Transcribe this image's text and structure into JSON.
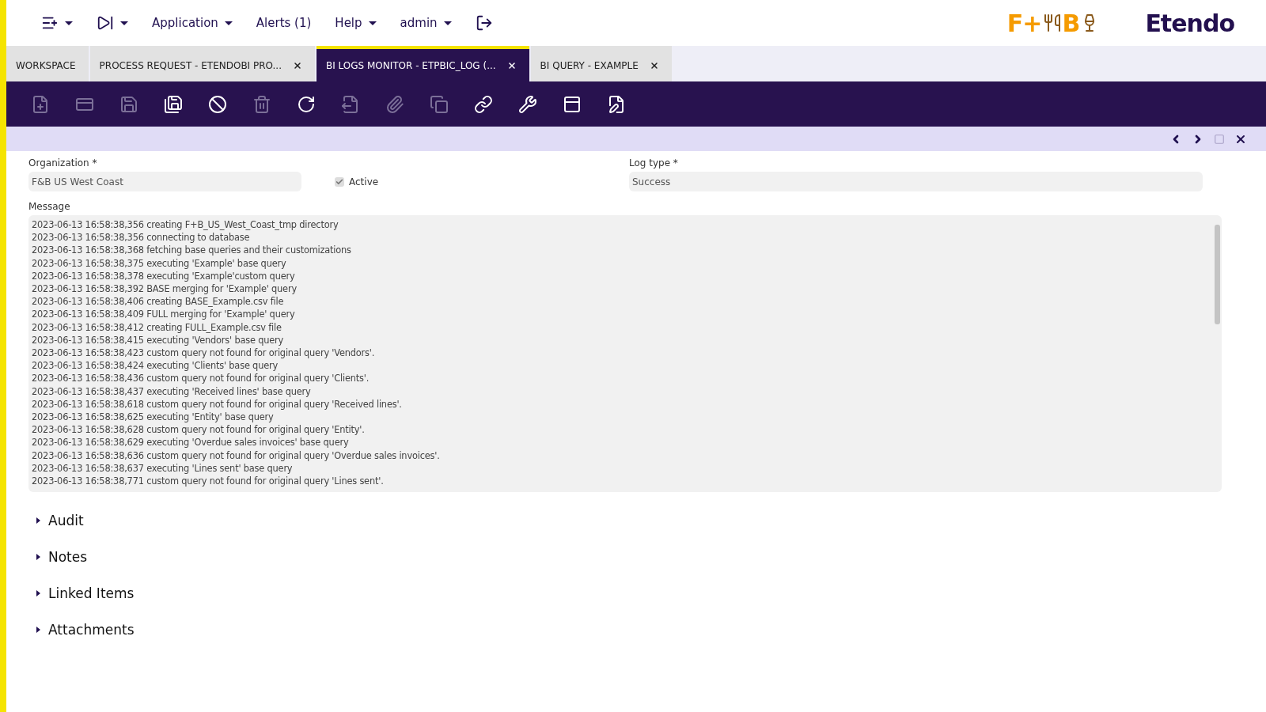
{
  "menu_bar": {
    "items": [
      {
        "kind": "icon"
      },
      {
        "kind": "icon"
      },
      {
        "kind": "dropdown",
        "label": "Application"
      },
      {
        "kind": "plain",
        "label": "Alerts (1)"
      },
      {
        "kind": "dropdown",
        "label": "Help"
      },
      {
        "kind": "dropdown",
        "label": "admin"
      },
      {
        "kind": "logout"
      }
    ]
  },
  "brand": {
    "client_logo": [
      "F+",
      "B"
    ],
    "product_logo": "Etendo"
  },
  "tabs": [
    {
      "label": "WORKSPACE",
      "selected": false,
      "closable": false
    },
    {
      "label": "PROCESS REQUEST - ETENDOBI PRO...",
      "selected": false,
      "closable": true
    },
    {
      "label": "BI LOGS MONITOR - ETPBIC_LOG (...",
      "selected": true,
      "closable": true
    },
    {
      "label": "BI QUERY - EXAMPLE",
      "selected": false,
      "closable": true
    }
  ],
  "toolbar": [
    {
      "kind": "new",
      "disabled": true
    },
    {
      "kind": "newrow",
      "disabled": true
    },
    {
      "kind": "save",
      "disabled": true
    },
    {
      "kind": "saveclose",
      "disabled": false
    },
    {
      "kind": "undo",
      "disabled": false
    },
    {
      "kind": "delete",
      "disabled": true
    },
    {
      "kind": "refresh",
      "disabled": false
    },
    {
      "kind": "export",
      "disabled": true
    },
    {
      "kind": "attach",
      "disabled": true
    },
    {
      "kind": "copy",
      "disabled": true
    },
    {
      "kind": "link",
      "disabled": false
    },
    {
      "kind": "tools",
      "disabled": false
    },
    {
      "kind": "view",
      "disabled": false
    },
    {
      "kind": "edit",
      "disabled": false
    }
  ],
  "form": {
    "organization": {
      "label": "Organization *",
      "value": "F&B US West Coast"
    },
    "active": {
      "label": "Active",
      "checked": true
    },
    "log_type": {
      "label": "Log type *",
      "value": "Success"
    },
    "message": {
      "label": "Message",
      "lines": [
        "2023-06-13 16:58:38,356 creating F+B_US_West_Coast_tmp directory",
        "2023-06-13 16:58:38,356 connecting to database",
        "2023-06-13 16:58:38,368 fetching base queries and their customizations",
        "2023-06-13 16:58:38,375 executing 'Example' base query",
        "2023-06-13 16:58:38,378 executing 'Example'custom query",
        "2023-06-13 16:58:38,392 BASE merging for 'Example' query",
        "2023-06-13 16:58:38,406 creating BASE_Example.csv file",
        "2023-06-13 16:58:38,409 FULL merging for 'Example' query",
        "2023-06-13 16:58:38,412 creating FULL_Example.csv file",
        "2023-06-13 16:58:38,415 executing 'Vendors' base query",
        "2023-06-13 16:58:38,423 custom query not found for original query 'Vendors'.",
        "2023-06-13 16:58:38,424 executing 'Clients' base query",
        "2023-06-13 16:58:38,436 custom query not found for original query 'Clients'.",
        "2023-06-13 16:58:38,437 executing 'Received lines' base query",
        "2023-06-13 16:58:38,618 custom query not found for original query 'Received lines'.",
        "2023-06-13 16:58:38,625 executing 'Entity' base query",
        "2023-06-13 16:58:38,628 custom query not found for original query 'Entity'.",
        "2023-06-13 16:58:38,629 executing 'Overdue sales invoices' base query",
        "2023-06-13 16:58:38,636 custom query not found for original query 'Overdue sales invoices'.",
        "2023-06-13 16:58:38,637 executing 'Lines sent' base query",
        "2023-06-13 16:58:38,771 custom query not found for original query 'Lines sent'."
      ]
    }
  },
  "sections": [
    {
      "label": "Audit",
      "expanded": false
    },
    {
      "label": "Notes",
      "expanded": false
    },
    {
      "label": "Linked Items",
      "expanded": false
    },
    {
      "label": "Attachments",
      "expanded": false
    }
  ]
}
